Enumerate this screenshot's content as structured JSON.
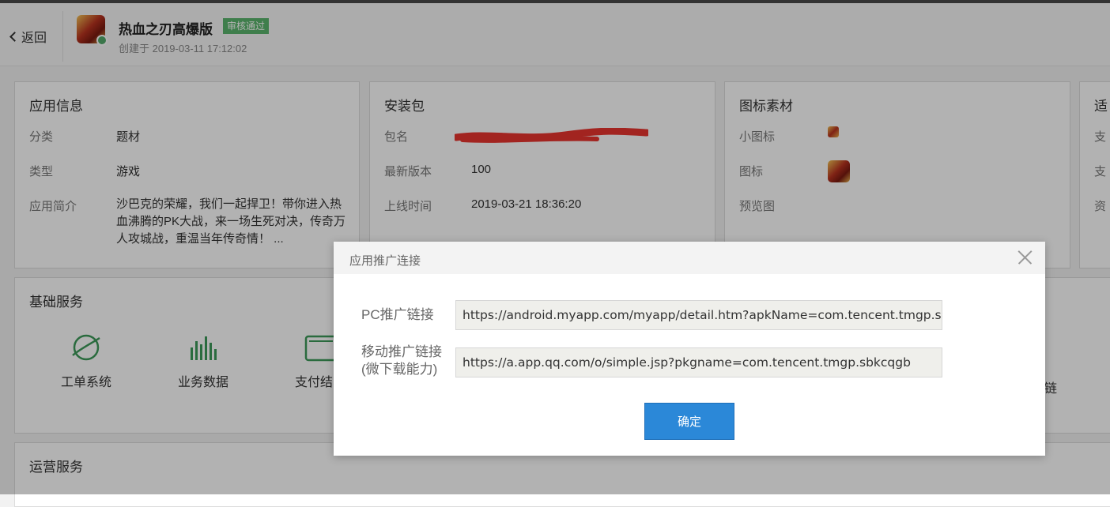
{
  "header": {
    "back_label": "返回",
    "app_name": "热血之刃高爆版",
    "status_badge": "审核通过",
    "created_at": "创建于 2019-03-11 17:12:02"
  },
  "app_info": {
    "title": "应用信息",
    "category_label": "分类",
    "category_value": "题材",
    "type_label": "类型",
    "type_value": "游戏",
    "intro_label": "应用简介",
    "intro_value": "沙巴克的荣耀，我们一起捍卫！带你进入热血沸腾的PK大战，来一场生死对决，传奇万人攻城战，重温当年传奇情！ ..."
  },
  "package": {
    "title": "安装包",
    "package_label": "包名",
    "version_label": "最新版本",
    "version_value": "100",
    "online_label": "上线时间",
    "online_value": "2019-03-21 18:36:20"
  },
  "icons": {
    "title": "图标素材",
    "small_icon_label": "小图标",
    "icon_label": "图标",
    "preview_label": "预览图"
  },
  "right_card": {
    "title": "适",
    "row1": "支",
    "row2": "支",
    "row3": "资"
  },
  "basic_services": {
    "title": "基础服务",
    "items": [
      "工单系统",
      "业务数据",
      "支付结"
    ],
    "cut_right": "链"
  },
  "ops_services": {
    "title": "运营服务"
  },
  "modal": {
    "title": "应用推广连接",
    "pc_label": "PC推广链接",
    "pc_value": "https://android.myapp.com/myapp/detail.htm?apkName=com.tencent.tmgp.sbkcqgb",
    "mobile_label_line1": "移动推广链接",
    "mobile_label_line2": "(微下载能力)",
    "mobile_value": "https://a.app.qq.com/o/simple.jsp?pkgname=com.tencent.tmgp.sbkcqgb",
    "confirm_label": "确定"
  },
  "colors": {
    "badge": "#5bb56d",
    "primary_button": "#2b88d8",
    "service_icon": "#3d9a5a",
    "redaction": "#e8342e"
  }
}
